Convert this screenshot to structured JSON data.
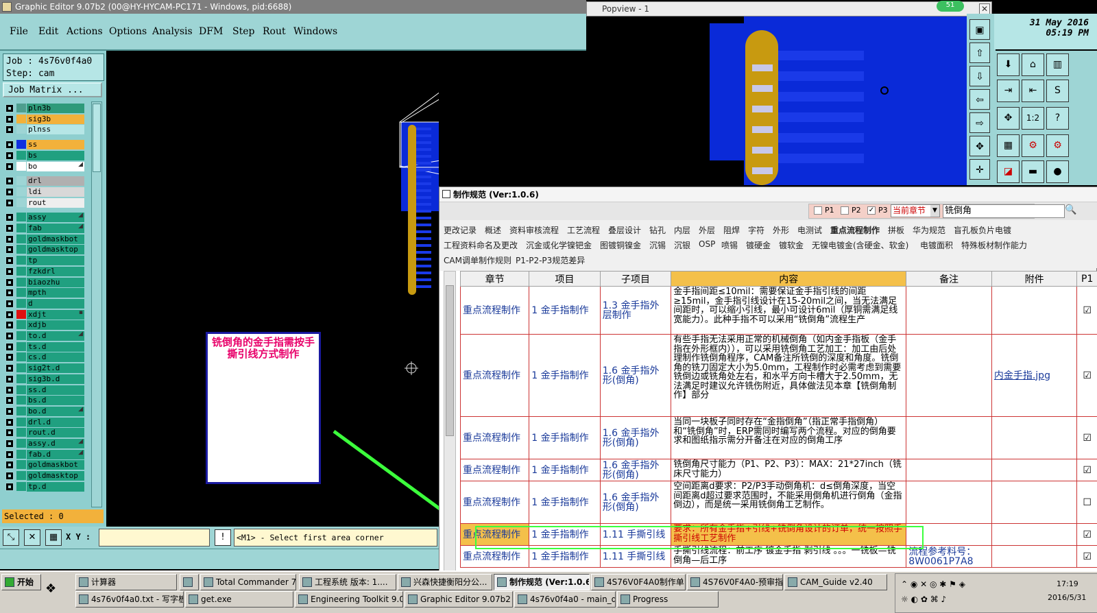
{
  "app": {
    "title": "Graphic Editor 9.07b2 (00@HY-HYCAM-PC171 - Windows, pid:6688)"
  },
  "menu": [
    "File",
    "Edit",
    "Actions",
    "Options",
    "Analysis",
    "DFM",
    "Step",
    "Rout",
    "Windows"
  ],
  "job": {
    "job_line": "Job : 4s76v0f4a0",
    "step_line": "Step: cam",
    "matrix_label": "Job Matrix ..."
  },
  "layers": [
    {
      "name": "pln3b",
      "color": "#4e9e8e",
      "bg": "#2e9a7a",
      "flag": ""
    },
    {
      "name": "sig3b",
      "color": "#f2b13b",
      "bg": "#f2b13b",
      "flag": ""
    },
    {
      "name": "plnss",
      "color": "#9ed5d5",
      "bg": "#b6e6e6",
      "flag": ""
    },
    {
      "name": "ss",
      "color": "#1030e0",
      "bg": "#f2b13b",
      "flag": ""
    },
    {
      "name": "bs",
      "color": "#20a080",
      "bg": "#20a080",
      "flag": ""
    },
    {
      "name": "bo",
      "color": "#ffffff",
      "bg": "#ffffff",
      "flag": "◢"
    },
    {
      "name": "drl",
      "color": "#9ed5d5",
      "bg": "#b0b0b0",
      "flag": ""
    },
    {
      "name": "ldi",
      "color": "#9ed5d5",
      "bg": "#d8d8d8",
      "flag": ""
    },
    {
      "name": "rout",
      "color": "#9ed5d5",
      "bg": "#eeeeee",
      "flag": ""
    },
    {
      "name": "assy",
      "color": "#20a080",
      "bg": "#20a080",
      "flag": "◢"
    },
    {
      "name": "fab",
      "color": "#20a080",
      "bg": "#20a080",
      "flag": "◢"
    },
    {
      "name": "goldmaskbot",
      "color": "#20a080",
      "bg": "#20a080",
      "flag": ""
    },
    {
      "name": "goldmasktop",
      "color": "#20a080",
      "bg": "#20a080",
      "flag": ""
    },
    {
      "name": "tp",
      "color": "#20a080",
      "bg": "#20a080",
      "flag": ""
    },
    {
      "name": "fzkdrl",
      "color": "#20a080",
      "bg": "#20a080",
      "flag": ""
    },
    {
      "name": "biaozhu",
      "color": "#20a080",
      "bg": "#20a080",
      "flag": ""
    },
    {
      "name": "mpth",
      "color": "#20a080",
      "bg": "#20a080",
      "flag": ""
    },
    {
      "name": "d",
      "color": "#20a080",
      "bg": "#20a080",
      "flag": ""
    },
    {
      "name": "xdjt",
      "color": "#e01010",
      "bg": "#20a080",
      "flag": "▪"
    },
    {
      "name": "xdjb",
      "color": "#20a080",
      "bg": "#20a080",
      "flag": ""
    },
    {
      "name": "to.d",
      "color": "#20a080",
      "bg": "#20a080",
      "flag": "◢"
    },
    {
      "name": "ts.d",
      "color": "#20a080",
      "bg": "#20a080",
      "flag": ""
    },
    {
      "name": "cs.d",
      "color": "#20a080",
      "bg": "#20a080",
      "flag": ""
    },
    {
      "name": "sig2t.d",
      "color": "#20a080",
      "bg": "#20a080",
      "flag": ""
    },
    {
      "name": "sig3b.d",
      "color": "#20a080",
      "bg": "#20a080",
      "flag": ""
    },
    {
      "name": "ss.d",
      "color": "#20a080",
      "bg": "#20a080",
      "flag": ""
    },
    {
      "name": "bs.d",
      "color": "#20a080",
      "bg": "#20a080",
      "flag": ""
    },
    {
      "name": "bo.d",
      "color": "#20a080",
      "bg": "#20a080",
      "flag": "◢"
    },
    {
      "name": "drl.d",
      "color": "#20a080",
      "bg": "#20a080",
      "flag": ""
    },
    {
      "name": "rout.d",
      "color": "#20a080",
      "bg": "#20a080",
      "flag": ""
    },
    {
      "name": "assy.d",
      "color": "#20a080",
      "bg": "#20a080",
      "flag": "◢"
    },
    {
      "name": "fab.d",
      "color": "#20a080",
      "bg": "#20a080",
      "flag": "◢"
    },
    {
      "name": "goldmaskbot",
      "color": "#20a080",
      "bg": "#20a080",
      "flag": ""
    },
    {
      "name": "goldmasktop",
      "color": "#20a080",
      "bg": "#20a080",
      "flag": ""
    },
    {
      "name": "tp.d",
      "color": "#20a080",
      "bg": "#20a080",
      "flag": ""
    }
  ],
  "selected": "Selected : 0",
  "bottom": {
    "xy_label": "X Y :",
    "xy_value": "",
    "prompt": "<M1> - Select first area corner",
    "warn": "!"
  },
  "canvas_note": "铣倒角的金手指需按手撕引线方式制作",
  "popview": {
    "title": "Popview - 1",
    "badge": "51"
  },
  "clock": {
    "date": "31 May 2016",
    "time": "05:19 PM"
  },
  "spec_window": {
    "title": "制作规范 (Ver:1.0.6)",
    "filters": {
      "p1": "P1",
      "p2": "P2",
      "p3": "P3",
      "scope": "当前章节",
      "search": "铣倒角"
    },
    "tabs_row1": [
      "更改记录",
      "概述",
      "资料审核流程",
      "工艺流程",
      "叠层设计",
      "钻孔",
      "内层",
      "外层",
      "阻焊",
      "字符",
      "外形",
      "电测试",
      "重点流程制作",
      "拼板",
      "华为规范",
      "盲孔板负片电镀"
    ],
    "tabs_row2": [
      "工程资料命名及更改",
      "沉金或化学镍钯金",
      "图镀铜镍金",
      "沉锡",
      "沉银",
      "OSP",
      "喷锡",
      "镀硬金",
      "镀软金",
      "无镍电镀金(含硬金、软金)",
      "电镀面积",
      "特殊板材制作能力"
    ],
    "tabs_row3": [
      "CAM调单制作规则",
      "P1-P2-P3规范差异"
    ],
    "columns": [
      "章节",
      "项目",
      "子项目",
      "内容",
      "备注",
      "附件",
      "P1"
    ],
    "rows": [
      {
        "chapter": "重点流程制作",
        "item": "1 金手指制作",
        "sub": "1.3 金手指外层制作",
        "content": "金手指间距≤10mil：需要保证金手指引线的间距≥15mil，金手指引线设计在15-20mil之间，当无法满足间距时，可以缩小引线，最小可设计6mil（厚铜需满足线宽能力）。此种手指不可以采用“铣倒角”流程生产",
        "note": "",
        "attach": "",
        "p1": "☑"
      },
      {
        "chapter": "重点流程制作",
        "item": "1 金手指制作",
        "sub": "1.6 金手指外形(倒角)",
        "content": "有些手指无法采用正常的机械倒角（如内金手指板（金手指在外形框内）），可以采用铣倒角工艺加工：加工由后处理制作铣倒角程序，CAM备注所铣倒的深度和角度。铣倒角的铣刀固定大小为5.0mm，工程制作时必需考虑到需要铣倒边或铣角处左右，和水平方向卡槽大于2.50mm，无法满足时建议允许铣伤附近，具体做法见本章【铣倒角制作】部分",
        "note": "",
        "attach": "内金手指.jpg",
        "p1": "☑"
      },
      {
        "chapter": "重点流程制作",
        "item": "1 金手指制作",
        "sub": "1.6 金手指外形(倒角)",
        "content": "当同一块板子同时存在“金指倒角”（指正常手指倒角）和“铣倒角”时，ERP需同时编写两个流程。对应的倒角要求和图纸指示需分开备注在对应的倒角工序",
        "note": "",
        "attach": "",
        "p1": "☑"
      },
      {
        "chapter": "重点流程制作",
        "item": "1 金手指制作",
        "sub": "1.6 金手指外形(倒角)",
        "content": "铣倒角尺寸能力（P1、P2、P3）：MAX：21*27inch（铣床尺寸能力）",
        "note": "",
        "attach": "",
        "p1": "☑"
      },
      {
        "chapter": "重点流程制作",
        "item": "1 金手指制作",
        "sub": "1.6 金手指外形(倒角)",
        "content": "空间距离d要求：P2/P3手动倒角机：d≤倒角深度，当空间距离d超过要求范围时，不能采用倒角机进行倒角（金指倒边），而是统一采用铣倒角工艺制作。",
        "note": "",
        "attach": "",
        "p1": "☐"
      },
      {
        "chapter": "重点流程制作",
        "item": "1 金手指制作",
        "sub": "1.11 手撕引线",
        "content": "要求：所有金手指+引线+铣倒角设计的订单，统一按照手撕引线工艺制作",
        "note": "",
        "attach": "",
        "p1": "☑"
      },
      {
        "chapter": "重点流程制作",
        "item": "1 金手指制作",
        "sub": "1.11 手撕引线",
        "content": "手撕引线流程：前工序 镀金手指 剥引线 。。。一铣板—铣倒角—后工序",
        "note": "流程参考料号：8W0061P7A8",
        "attach": "",
        "p1": "☑"
      }
    ]
  },
  "taskbar": {
    "start": "开始",
    "row1": [
      "计算器",
      "",
      "Total Commander 7.0...",
      "工程系统 版本: 1....",
      "兴森快捷衡阳分公...",
      "制作规范 (Ver:1.0.6)",
      "4S76V0F4A0制作单....",
      "4S76V0F4A0-预审指...",
      "CAM_Guide v2.40"
    ],
    "row2": [
      "4s76v0f4a0.txt - 写字板",
      "get.exe",
      "Engineering Toolkit 9.07...",
      "Graphic Editor 9.07b2 (0...",
      "4s76v0f4a0 - main_qa",
      "Progress"
    ],
    "time": "17:19",
    "date": "2016/5/31"
  }
}
